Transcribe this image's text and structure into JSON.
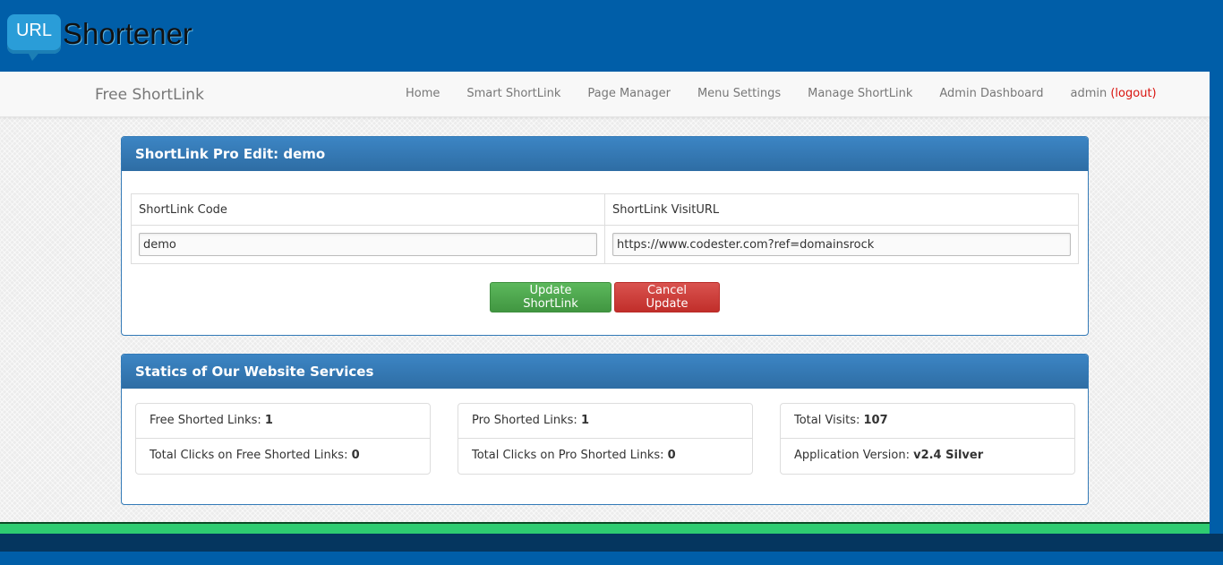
{
  "logo": {
    "badge": "URL",
    "name": "Shortener"
  },
  "navbar": {
    "brand": "Free ShortLink",
    "links": [
      "Home",
      "Smart ShortLink",
      "Page Manager",
      "Menu Settings",
      "Manage ShortLink",
      "Admin Dashboard"
    ],
    "user": "admin",
    "logout": "(logout)"
  },
  "edit_panel": {
    "title": "ShortLink Pro Edit: demo",
    "code_label": "ShortLink Code",
    "url_label": "ShortLink VisitURL",
    "code_value": "demo",
    "url_value": "https://www.codester.com?ref=domainsrock",
    "update_button": "Update ShortLink",
    "cancel_button": "Cancel Update"
  },
  "stats_panel": {
    "title": "Statics of Our Website Services",
    "boxes": [
      [
        {
          "label": "Free Shorted Links:",
          "value": "1"
        },
        {
          "label": "Total Clicks on Free Shorted Links:",
          "value": "0"
        }
      ],
      [
        {
          "label": "Pro Shorted Links:",
          "value": "1"
        },
        {
          "label": "Total Clicks on Pro Shorted Links:",
          "value": "0"
        }
      ],
      [
        {
          "label": "Total Visits:",
          "value": "107"
        },
        {
          "label": "Application Version:",
          "value": "v2.4 Silver"
        }
      ]
    ]
  },
  "colors": {
    "header_blue": "#005ea8",
    "panel_heading": "#337ab7",
    "success": "#5cb85c",
    "danger": "#d9534f",
    "logout": "#d9140f",
    "footer_green": "#2ecc71"
  }
}
